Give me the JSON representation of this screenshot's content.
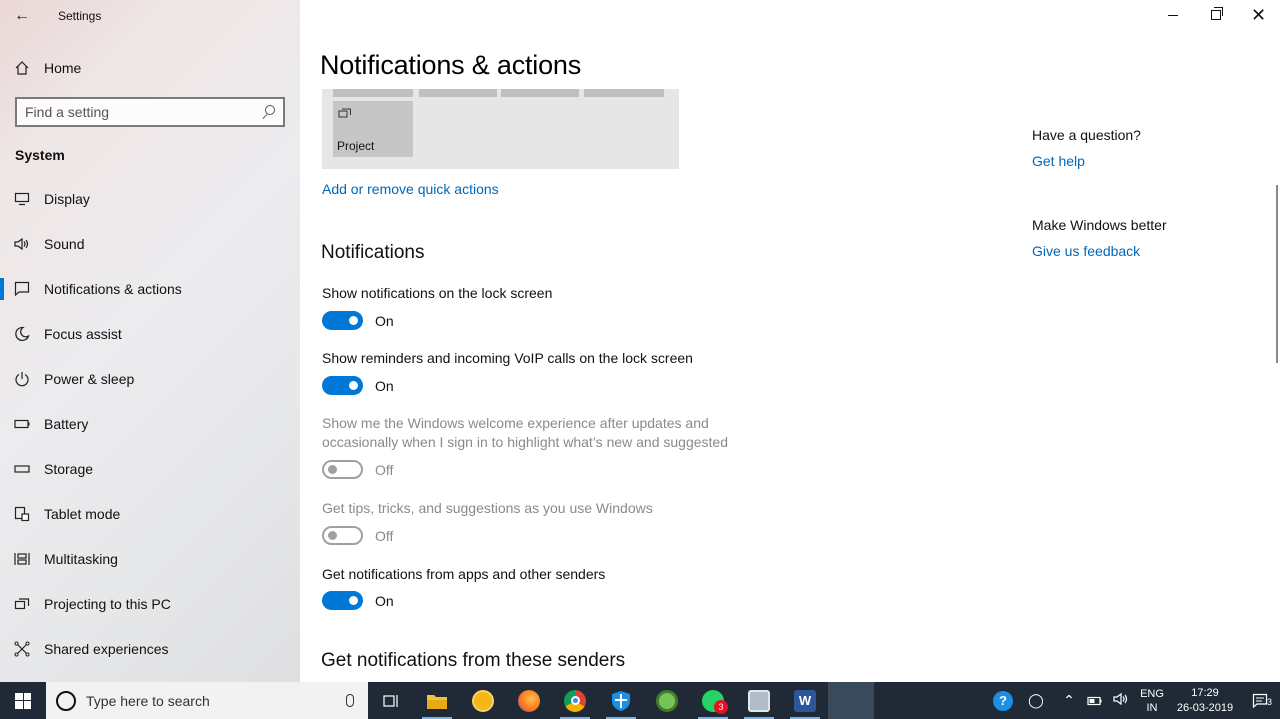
{
  "window": {
    "app_title": "Settings",
    "controls": {
      "minimize": "Minimize",
      "maximize": "Restore",
      "close": "Close"
    }
  },
  "sidebar": {
    "home_label": "Home",
    "search_placeholder": "Find a setting",
    "section_label": "System",
    "items": [
      {
        "label": "Display",
        "icon": "monitor-icon"
      },
      {
        "label": "Sound",
        "icon": "speaker-icon"
      },
      {
        "label": "Notifications & actions",
        "icon": "message-icon",
        "active": true
      },
      {
        "label": "Focus assist",
        "icon": "moon-icon"
      },
      {
        "label": "Power & sleep",
        "icon": "power-icon"
      },
      {
        "label": "Battery",
        "icon": "battery-icon"
      },
      {
        "label": "Storage",
        "icon": "storage-icon"
      },
      {
        "label": "Tablet mode",
        "icon": "tablet-icon"
      },
      {
        "label": "Multitasking",
        "icon": "multitasking-icon"
      },
      {
        "label": "Projecting to this PC",
        "icon": "projecting-icon"
      },
      {
        "label": "Shared experiences",
        "icon": "shared-icon"
      }
    ]
  },
  "main": {
    "page_title": "Notifications & actions",
    "quick_actions": {
      "tile_label": "Project",
      "add_remove_link": "Add or remove quick actions"
    },
    "notifications_heading": "Notifications",
    "settings": [
      {
        "label": "Show notifications on the lock screen",
        "state": "On",
        "enabled": true,
        "on": true
      },
      {
        "label": "Show reminders and incoming VoIP calls on the lock screen",
        "state": "On",
        "enabled": true,
        "on": true
      },
      {
        "label": "Show me the Windows welcome experience after updates and occasionally when I sign in to highlight what’s new and suggested",
        "state": "Off",
        "enabled": false,
        "on": false
      },
      {
        "label": "Get tips, tricks, and suggestions as you use Windows",
        "state": "Off",
        "enabled": false,
        "on": false
      },
      {
        "label": "Get notifications from apps and other senders",
        "state": "On",
        "enabled": true,
        "on": true
      }
    ],
    "senders_heading": "Get notifications from these senders"
  },
  "aside": {
    "question_heading": "Have a question?",
    "get_help": "Get help",
    "better_heading": "Make Windows better",
    "feedback": "Give us feedback"
  },
  "taskbar": {
    "search_placeholder": "Type here to search",
    "apps": [
      {
        "name": "task-view-icon"
      },
      {
        "name": "file-explorer-icon",
        "color": "#f3c23c"
      },
      {
        "name": "app-circle-icon",
        "color": "#f5b617"
      },
      {
        "name": "firefox-icon",
        "color": "#ff7a1a"
      },
      {
        "name": "chrome-icon",
        "color": "#3d9b46"
      },
      {
        "name": "shield-icon",
        "color": "#1a8fe3"
      },
      {
        "name": "android-icon",
        "color": "#78c257"
      },
      {
        "name": "whatsapp-icon",
        "color": "#25d366",
        "badge": "3"
      },
      {
        "name": "window-app-icon",
        "color": "#b0bcc8"
      },
      {
        "name": "word-icon",
        "color": "#2b579a"
      }
    ],
    "language_line1": "ENG",
    "language_line2": "IN",
    "time": "17:29",
    "date": "26-03-2019",
    "notification_count": "3"
  },
  "colors": {
    "accent": "#0078d7",
    "link": "#0067b8",
    "taskbar": "#1f2a36"
  }
}
